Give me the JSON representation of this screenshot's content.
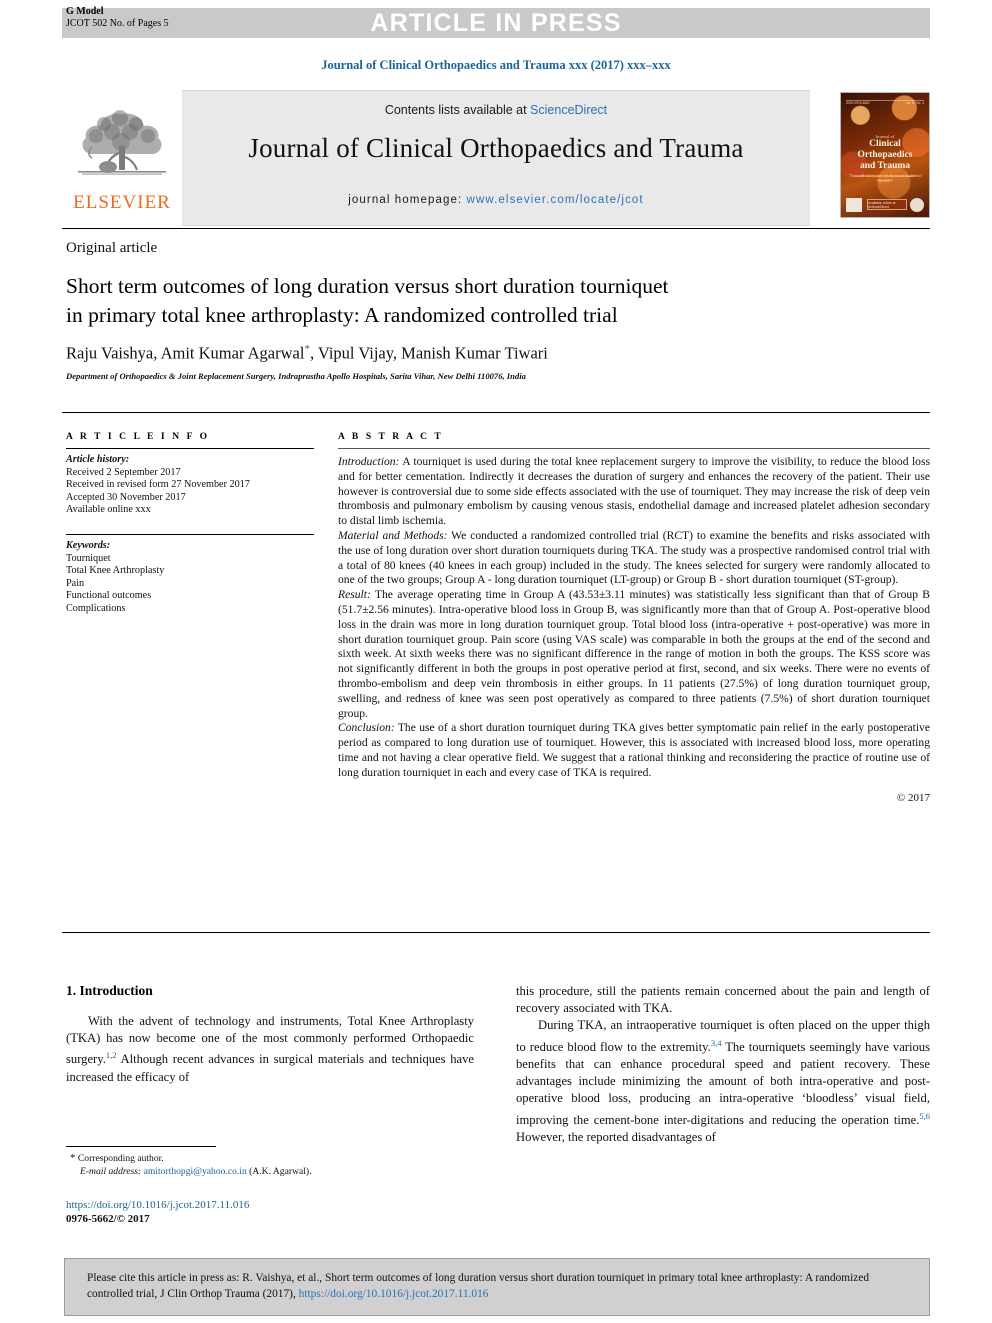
{
  "header": {
    "g_model_line1": "G Model",
    "g_model_line2": "JCOT 502 No. of Pages 5",
    "article_in_press": "ARTICLE IN PRESS",
    "running_head": "Journal of Clinical Orthopaedics and Trauma xxx (2017) xxx–xxx"
  },
  "masthead": {
    "contents_prefix": "Contents lists available at ",
    "sciencedirect": "ScienceDirect",
    "journal_title": "Journal of Clinical Orthopaedics and Trauma",
    "homepage_label": "journal homepage: ",
    "homepage_url": "www.elsevier.com/locate/jcot",
    "elsevier_wordmark": "ELSEVIER",
    "cover": {
      "top_left": "ISSN 0976-5662",
      "top_right": "Vol. 8 / No. 4",
      "eyebrow": "Journal of",
      "title_line1": "Clinical Orthopaedics",
      "title_line2": "and Trauma",
      "subtitle": "An Official Journal of the Delhi Orthopaedic Association",
      "tagline": "\"Towards better care of the musculoskeletal system\"",
      "badge": "Available online at ScienceDirect"
    }
  },
  "article": {
    "type": "Original article",
    "title_line1": "Short term outcomes of long duration versus short duration tourniquet",
    "title_line2": "in primary total knee arthroplasty: A randomized controlled trial",
    "authors_pre": "Raju Vaishya, Amit Kumar Agarwal",
    "authors_marker": "*",
    "authors_post": ", Vipul Vijay, Manish Kumar Tiwari",
    "affiliation": "Department of Orthopaedics & Joint Replacement Surgery, Indraprastha Apollo Hospitals, Sarita Vihar, New Delhi 110076, India"
  },
  "article_info": {
    "heading": "A R T I C L E   I N F O",
    "history_label": "Article history:",
    "history": [
      "Received 2 September 2017",
      "Received in revised form 27 November 2017",
      "Accepted 30 November 2017",
      "Available online xxx"
    ],
    "keywords_label": "Keywords:",
    "keywords": [
      "Tourniquet",
      "Total Knee Arthroplasty",
      "Pain",
      "Functional outcomes",
      "Complications"
    ]
  },
  "abstract": {
    "heading": "A B S T R A C T",
    "introduction_label": "Introduction:",
    "introduction_text": " A tourniquet is used during the total knee replacement surgery to improve the visibility, to reduce the blood loss and for better cementation. Indirectly it decreases the duration of surgery and enhances the recovery of the patient. Their use however is controversial due to some side effects associated with the use of tourniquet. They may increase the risk of deep vein thrombosis and pulmonary embolism by causing venous stasis, endothelial damage and increased platelet adhesion secondary to distal limb ischemia.",
    "methods_label": "Material and Methods:",
    "methods_text": " We conducted a randomized controlled trial (RCT) to examine the benefits and risks associated with the use of long duration over short duration tourniquets during TKA. The study was a prospective randomised control trial with a total of 80 knees (40 knees in each group) included in the study. The knees selected for surgery were randomly allocated to one of the two groups; Group A - long duration tourniquet (LT-group) or Group B - short duration tourniquet (ST-group).",
    "result_label": "Result:",
    "result_text": " The average operating time in Group A (43.53±3.11 minutes) was statistically less significant than that of Group B (51.7±2.56 minutes). Intra-operative blood loss in Group B, was significantly more than that of Group A. Post-operative blood loss in the drain was more in long duration tourniquet group. Total blood loss (intra-operative + post-operative) was more in short duration tourniquet group. Pain score (using VAS scale) was comparable in both the groups at the end of the second and sixth week. At sixth weeks there was no significant difference in the range of motion in both the groups. The KSS score was not significantly different in both the groups in post operative period at first, second, and six weeks. There were no events of thrombo-embolism and deep vein thrombosis in either groups. In 11 patients (27.5%) of long duration tourniquet group, swelling, and redness of knee was seen post operatively as compared to three patients (7.5%) of short duration tourniquet group.",
    "conclusion_label": "Conclusion:",
    "conclusion_text": " The use of a short duration tourniquet during TKA gives better symptomatic pain relief in the early postoperative period as compared to long duration use of tourniquet. However, this is associated with increased blood loss, more operating time and not having a clear operative field. We suggest that a rational thinking and reconsidering the practice of routine use of long duration tourniquet in each and every case of TKA is required.",
    "copyright": "© 2017"
  },
  "body": {
    "section_heading": "1. Introduction",
    "left_para": "With the advent of technology and instruments, Total Knee Arthroplasty (TKA) has now become one of the most commonly performed Orthopaedic surgery.",
    "left_para_ref": "1,2",
    "left_para_cont": " Although recent advances in surgical materials and techniques have increased the efficacy of",
    "right_para1": "this procedure, still the patients remain concerned about the pain and length of recovery associated with TKA.",
    "right_para2_a": "During TKA, an intraoperative tourniquet is often placed on the upper thigh to reduce blood flow to the extremity.",
    "right_para2_ref1": "3,4",
    "right_para2_b": " The tourniquets seemingly have various benefits that can enhance procedural speed and patient recovery. These advantages include minimizing the amount of both intra-operative and post-operative blood loss, producing an intra-operative ‘bloodless’ visual field, improving the cement-bone inter-digitations and reducing the operation time.",
    "right_para2_ref2": "5,6",
    "right_para2_c": " However, the reported disadvantages of"
  },
  "footnotes": {
    "corresponding_marker": "*",
    "corresponding_label": "Corresponding author.",
    "email_label": "E-mail address:",
    "email": "amitorthopgi@yahoo.co.in",
    "email_owner": " (A.K. Agarwal).",
    "doi": "https://doi.org/10.1016/j.jcot.2017.11.016",
    "issn": "0976-5662/© 2017"
  },
  "citation": {
    "text_before": "Please cite this article in press as: R. Vaishya, et al., Short term outcomes of long duration versus short duration tourniquet in primary total knee arthroplasty: A randomized controlled trial, J Clin Orthop Trauma (2017), ",
    "link": "https://doi.org/10.1016/j.jcot.2017.11.016"
  }
}
